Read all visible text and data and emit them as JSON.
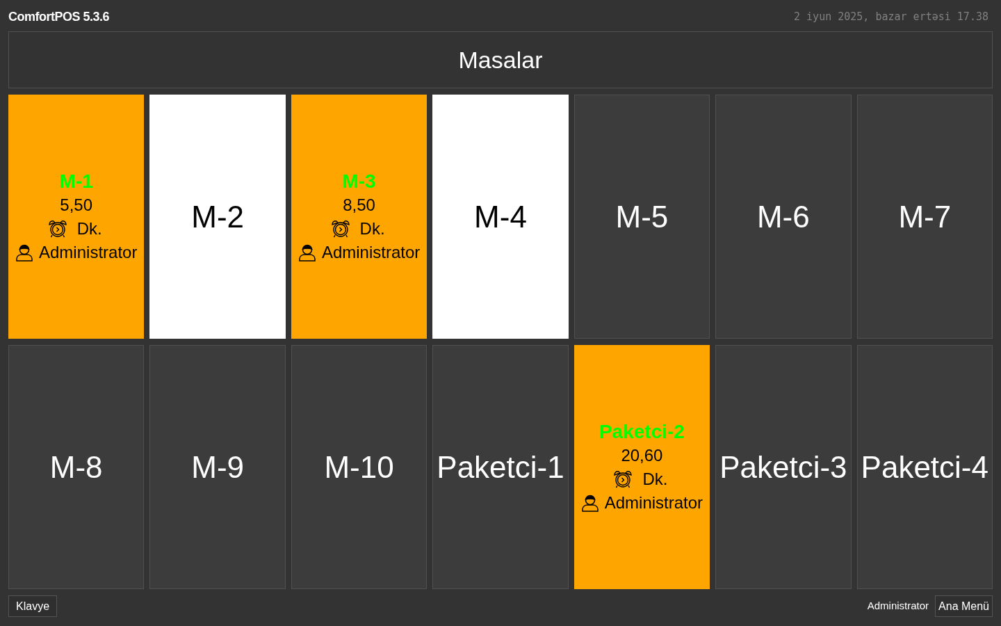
{
  "app": {
    "title": "ComfortPOS 5.3.6",
    "datetime": "2 iyun 2025, bazar ertəsi 17.38"
  },
  "header": {
    "title": "Masalar"
  },
  "tables": [
    {
      "kind": "order",
      "name": "M-1",
      "color": "#ffa500",
      "amount": "5,50",
      "duration": "Dk.",
      "user": "Administrator"
    },
    {
      "kind": "plain",
      "name": "M-2",
      "color": "#ffffff"
    },
    {
      "kind": "order",
      "name": "M-3",
      "color": "#ffa500",
      "amount": "8,50",
      "duration": "Dk.",
      "user": "Administrator"
    },
    {
      "kind": "plain",
      "name": "M-4",
      "color": "#ffffff"
    },
    {
      "kind": "plain",
      "name": "M-5",
      "color": "#3c3c3c"
    },
    {
      "kind": "plain",
      "name": "M-6",
      "color": "#3c3c3c"
    },
    {
      "kind": "plain",
      "name": "M-7",
      "color": "#3c3c3c"
    },
    {
      "kind": "plain",
      "name": "M-8",
      "color": "#3c3c3c"
    },
    {
      "kind": "plain",
      "name": "M-9",
      "color": "#3c3c3c"
    },
    {
      "kind": "plain",
      "name": "M-10",
      "color": "#3c3c3c"
    },
    {
      "kind": "plain",
      "name": "Paketci-1",
      "color": "#3c3c3c"
    },
    {
      "kind": "order",
      "name": "Paketci-2",
      "color": "#ffa500",
      "amount": "20,60",
      "duration": "Dk.",
      "user": "Administrator"
    },
    {
      "kind": "plain",
      "name": "Paketci-3",
      "color": "#3c3c3c"
    },
    {
      "kind": "plain",
      "name": "Paketci-4",
      "color": "#3c3c3c"
    }
  ],
  "footer": {
    "keyboard_button": "Klavye",
    "user": "Administrator",
    "menu_button": "Ana Menü"
  }
}
